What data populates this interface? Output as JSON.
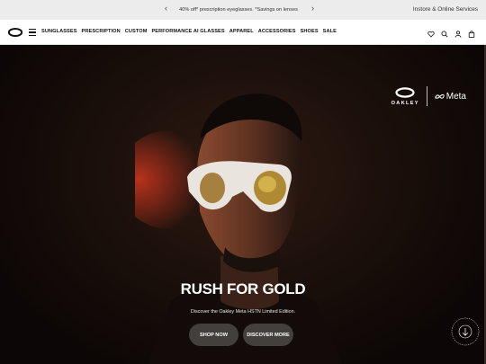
{
  "promo": {
    "message": "40% off* prescription eyeglasses. *Savings on lenses",
    "prev_icon": "chevron-left-icon",
    "next_icon": "chevron-right-icon",
    "services": "Instore & Online Services"
  },
  "nav": {
    "logo": "oakley-ellipse-logo",
    "menu_icon": "hamburger-icon",
    "links": [
      "SUNGLASSES",
      "PRESCRIPTION",
      "CUSTOM",
      "PERFORMANCE AI GLASSES",
      "APPAREL",
      "ACCESSORIES",
      "SHOES",
      "SALE"
    ],
    "icons": [
      "heart-icon",
      "search-icon",
      "user-icon",
      "bag-icon"
    ]
  },
  "hero": {
    "brand_oakley": "OAKLEY",
    "brand_meta": "Meta",
    "headline": "RUSH FOR GOLD",
    "subline": "Discover the Oakley Meta HSTN Limited Edition.",
    "shop_label": "SHOP NOW",
    "discover_label": "DISCOVER MORE",
    "badge_icon": "rotating-badge-arrow-icon"
  },
  "colors": {
    "promo_bg": "#ececec",
    "hero_bg": "#1c100b",
    "cta_bg": "#464442",
    "text_light": "#ffffff"
  }
}
